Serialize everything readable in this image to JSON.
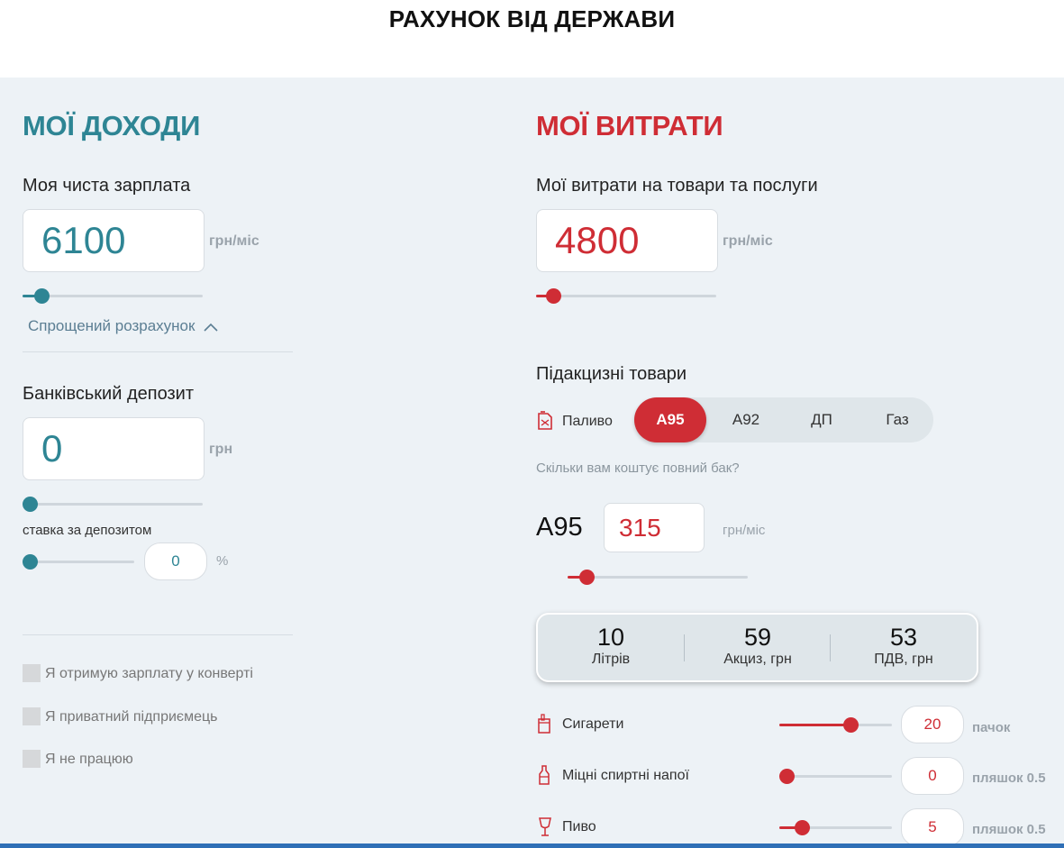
{
  "header": {
    "title": "РАХУНОК ВІД ДЕРЖАВИ"
  },
  "colors": {
    "income_accent": "#2e8594",
    "expense_accent": "#cf2d35",
    "panel_bg": "#edf2f6"
  },
  "income": {
    "title": "МОЇ ДОХОДИ",
    "salary": {
      "label": "Моя чиста зарплата",
      "value": "6100",
      "unit": "грн/міс",
      "slider_fraction": 0.1
    },
    "simplified_link": "Спрощений розрахунок",
    "deposit": {
      "label": "Банківський депозит",
      "value": "0",
      "unit": "грн",
      "slider_fraction": 0.0
    },
    "rate": {
      "label": "ставка за депозитом",
      "value": "0",
      "unit": "%",
      "slider_fraction": 0.0
    },
    "checkboxes": [
      {
        "label": "Я отримую зарплату у конверті",
        "checked": false
      },
      {
        "label": "Я приватний підприємець",
        "checked": false
      },
      {
        "label": "Я не працюю",
        "checked": false
      }
    ]
  },
  "expenses": {
    "title": "МОЇ ВИТРАТИ",
    "goods": {
      "label": "Мої витрати на товари та послуги",
      "value": "4800",
      "unit": "грн/міс",
      "slider_fraction": 0.1
    },
    "excise_title": "Підакцизні товари",
    "fuel": {
      "label": "Паливо",
      "options": [
        "А95",
        "А92",
        "ДП",
        "Газ"
      ],
      "selected": "А95",
      "question": "Скільки вам коштує повний бак?",
      "current_name": "А95",
      "value": "315",
      "unit": "грн/міс",
      "slider_fraction": 0.11
    },
    "stats": [
      {
        "value": "10",
        "label": "Літрів"
      },
      {
        "value": "59",
        "label": "Акциз, грн"
      },
      {
        "value": "53",
        "label": "ПДВ, грн"
      }
    ],
    "items": [
      {
        "label": "Сигарети",
        "value": "20",
        "unit": "пачок",
        "slider_fraction": 0.72
      },
      {
        "label": "Міцні спиртні напої",
        "value": "0",
        "unit": "пляшок 0.5",
        "slider_fraction": 0.0
      },
      {
        "label": "Пиво",
        "value": "5",
        "unit": "пляшок 0.5",
        "slider_fraction": 0.22
      }
    ]
  }
}
